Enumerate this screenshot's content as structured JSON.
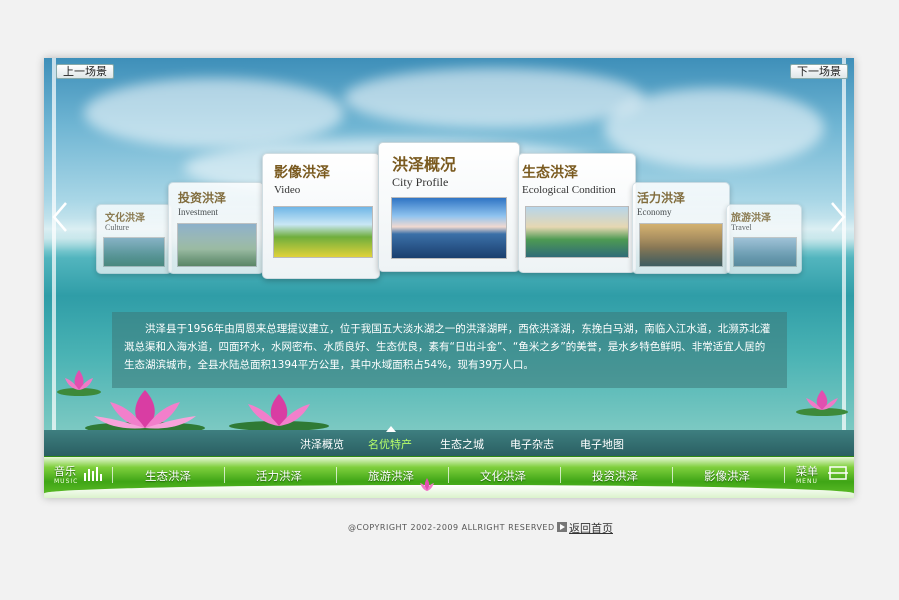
{
  "scene": {
    "prev_label": "上一场景",
    "next_label": "下一场景"
  },
  "cards": [
    {
      "cn": "文化洪泽",
      "en": "Culture"
    },
    {
      "cn": "投资洪泽",
      "en": "Investment"
    },
    {
      "cn": "影像洪泽",
      "en": "Video"
    },
    {
      "cn": "洪泽概况",
      "en": "City Profile"
    },
    {
      "cn": "生态洪泽",
      "en": "Ecological Condition"
    },
    {
      "cn": "活力洪泽",
      "en": "Economy"
    },
    {
      "cn": "旅游洪泽",
      "en": "Travel"
    }
  ],
  "description": "洪泽县于1956年由周恩来总理提议建立，位于我国五大淡水湖之一的洪泽湖畔，西依洪泽湖，东挽白马湖，南临入江水道，北濒苏北灌溉总渠和入海水道，四面环水，水网密布、水质良好、生态优良，素有“日出斗金”、“鱼米之乡”的美誉，是水乡特色鲜明、非常适宜人居的生态湖滨城市，全县水陆总面积1394平方公里，其中水域面积占54%，现有39万人口。",
  "subnav": [
    "洪泽概览",
    "名优特产",
    "生态之城",
    "电子杂志",
    "电子地图"
  ],
  "mainnav": {
    "music_label": "音乐",
    "music_en": "MUSIC",
    "items": [
      "生态洪泽",
      "活力洪泽",
      "旅游洪泽",
      "文化洪泽",
      "投资洪泽",
      "影像洪泽"
    ],
    "menu_label": "菜单",
    "menu_en": "MENU"
  },
  "footer": {
    "copyright": "@COPYRIGHT 2002-2009 ALLRIGHT RESERVED",
    "home_link": "返回首页"
  },
  "colors": {
    "nav_green": "#3fa516",
    "subnav_teal": "#2a5f62",
    "highlight": "#b8ff6a"
  }
}
